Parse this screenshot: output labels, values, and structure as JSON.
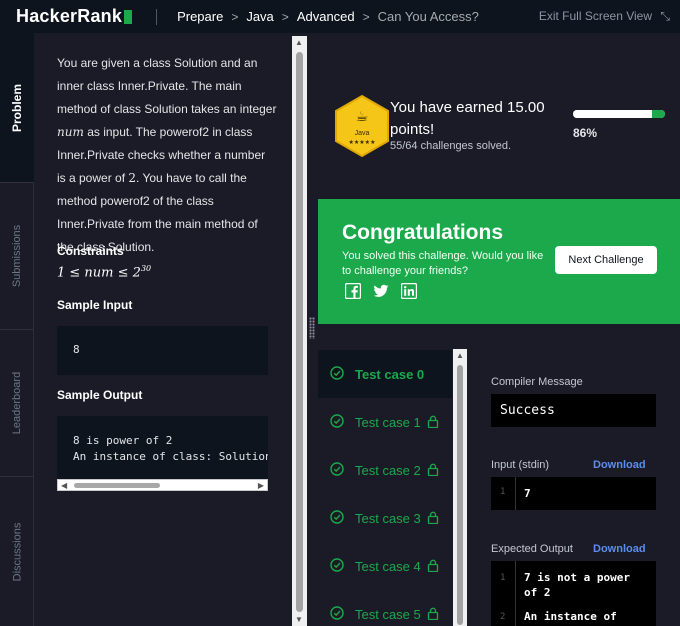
{
  "header": {
    "logo": "HackerRank",
    "breadcrumbs": [
      "Prepare",
      "Java",
      "Advanced",
      "Can You Access?"
    ],
    "exit_label": "Exit Full Screen View"
  },
  "sidetabs": [
    "Problem",
    "Submissions",
    "Leaderboard",
    "Discussions"
  ],
  "problem": {
    "p1": "You are given a class Solution and an inner class Inner.Private. The main method of class Solution takes an integer",
    "var_num": "num",
    "p2": "as input. The powerof2 in class Inner.Private checks whether a number is a power of",
    "two": "2",
    "p3": ". You have to call the method powerof2 of the class Inner.Private from the main method of the class Solution.",
    "constraints_title": "Constraints",
    "constraint": "1 ≤ num ≤ 2",
    "constraint_exp": "30",
    "sample_input_title": "Sample Input",
    "sample_input": "8",
    "sample_output_title": "Sample Output",
    "sample_output": [
      "8 is power of 2",
      "An instance of class: Solution.Inner.Private has been created"
    ]
  },
  "result": {
    "earned": "You have earned 15.00 points!",
    "solved": "55/64 challenges solved.",
    "progress_percent": 86,
    "progress_label": "86%",
    "badge_label": "Java",
    "badge_stars": "★★★★★",
    "congrats_title": "Congratulations",
    "congrats_msg": "You solved this challenge. Would you like to challenge your friends?",
    "next_label": "Next Challenge"
  },
  "testcases": [
    {
      "label": "Test case 0",
      "locked": false,
      "active": true
    },
    {
      "label": "Test case 1",
      "locked": true,
      "active": false
    },
    {
      "label": "Test case 2",
      "locked": true,
      "active": false
    },
    {
      "label": "Test case 3",
      "locked": true,
      "active": false
    },
    {
      "label": "Test case 4",
      "locked": true,
      "active": false
    },
    {
      "label": "Test case 5",
      "locked": true,
      "active": false
    }
  ],
  "output": {
    "compiler_label": "Compiler Message",
    "compiler_msg": "Success",
    "input_label": "Input (stdin)",
    "download": "Download",
    "input_line_no": "1",
    "input_value": "7",
    "expected_label": "Expected Output",
    "expected_line_no_1": "1",
    "expected_line_1": "7 is not a power of 2",
    "expected_line_no_2": "2",
    "expected_line_2": "An instance of"
  },
  "colors": {
    "accent_green": "#1ba94c",
    "header_bg": "#0e141e",
    "link_blue": "#5b8def"
  }
}
